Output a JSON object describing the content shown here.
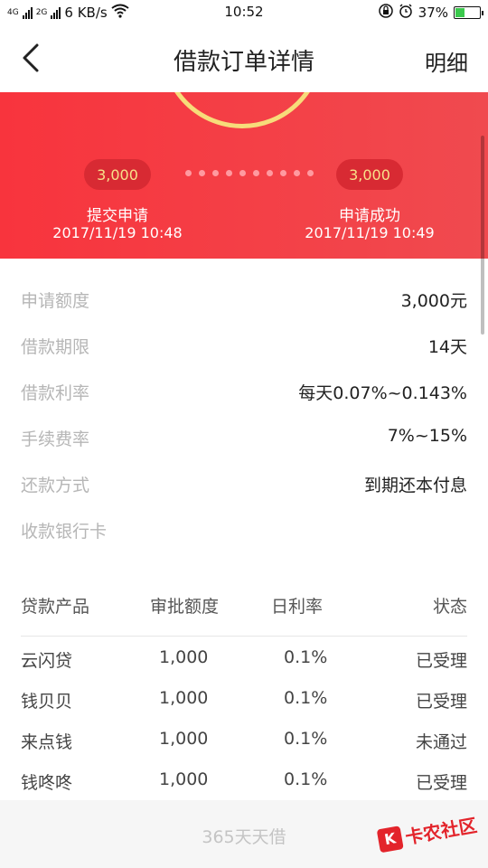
{
  "status_bar": {
    "net_left": "4G",
    "net_right": "2G",
    "speed": "6 KB/s",
    "time": "10:52",
    "battery": "37%",
    "battery_level": 0.37,
    "icons": [
      "signal-icon",
      "wifi-icon",
      "lock-icon",
      "alarm-icon",
      "battery-icon"
    ]
  },
  "header": {
    "title": "借款订单详情",
    "right_action": "明细",
    "back_icon": "back-arrow-icon"
  },
  "banner": {
    "accent": "#f8343d",
    "steps": [
      {
        "amount": "3,000",
        "label": "提交申请",
        "time": "2017/11/19 10:48"
      },
      {
        "amount": "3,000",
        "label": "申请成功",
        "time": "2017/11/19 10:49"
      }
    ]
  },
  "info": [
    {
      "label": "申请额度",
      "value": "3,000元"
    },
    {
      "label": "借款期限",
      "value": "14天"
    },
    {
      "label": "借款利率",
      "value": "每天0.07%~0.143%"
    },
    {
      "label": "手续费率",
      "value": "7%~15%"
    },
    {
      "label": "还款方式",
      "value": "到期还本付息"
    },
    {
      "label": "收款银行卡",
      "value": ""
    }
  ],
  "table": {
    "headers": [
      "贷款产品",
      "审批额度",
      "日利率",
      "状态"
    ],
    "rows": [
      [
        "云闪贷",
        "1,000",
        "0.1%",
        "已受理"
      ],
      [
        "钱贝贝",
        "1,000",
        "0.1%",
        "已受理"
      ],
      [
        "来点钱",
        "1,000",
        "0.1%",
        "未通过"
      ],
      [
        "钱咚咚",
        "1,000",
        "0.1%",
        "已受理"
      ]
    ]
  },
  "bottom": {
    "button_text": "365天天借"
  },
  "watermark": {
    "text": "卡农社区",
    "logo": "K"
  }
}
